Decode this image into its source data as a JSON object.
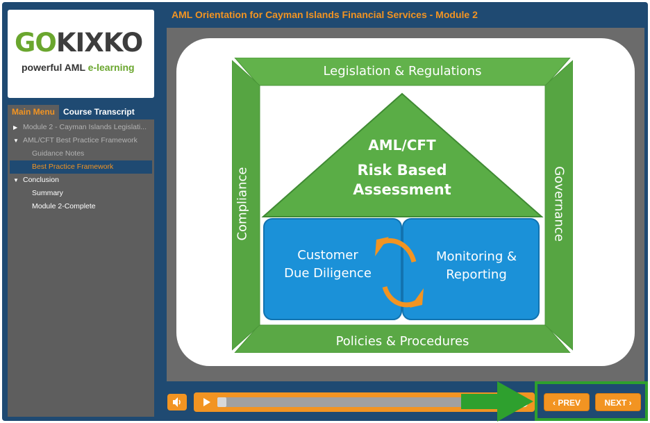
{
  "logo": {
    "brand_go": "GO",
    "brand_rest": "KIXKO",
    "tagline_prefix": "powerful AML ",
    "tagline_accent": "e-learning"
  },
  "tabs": [
    {
      "label": "Main Menu",
      "active": true
    },
    {
      "label": "Course Transcript",
      "active": false
    }
  ],
  "menu": {
    "items": [
      {
        "label": "Module 2 - Cayman Islands Legislati...",
        "icon": "triangle-right-icon"
      },
      {
        "label": "AML/CFT Best Practice Framework",
        "icon": "triangle-down-icon"
      },
      {
        "label": "Guidance Notes"
      },
      {
        "label": "Best Practice Framework",
        "selected": true
      },
      {
        "label": "Conclusion",
        "icon": "triangle-down-icon"
      },
      {
        "label": "Summary"
      },
      {
        "label": "Module 2-Complete"
      }
    ]
  },
  "course_title": "AML Orientation for Cayman Islands Financial Services - Module 2",
  "diagram": {
    "top": "Legislation & Regulations",
    "left": "Compliance",
    "right": "Governance",
    "bottom": "Policies & Procedures",
    "roof_line1": "AML/CFT",
    "roof_line2": "Risk Based",
    "roof_line3": "Assessment",
    "box_left_line1": "Customer",
    "box_left_line2": "Due Diligence",
    "box_right_line1": "Monitoring &",
    "box_right_line2": "Reporting"
  },
  "player": {
    "progress": 0.03,
    "prev_label": "PREV",
    "next_label": "NEXT"
  },
  "colors": {
    "accent": "#f29422",
    "frame": "#1f4a72",
    "green": "#5fae4a",
    "blue": "#1a8fd6",
    "highlight": "#2ea02e"
  }
}
